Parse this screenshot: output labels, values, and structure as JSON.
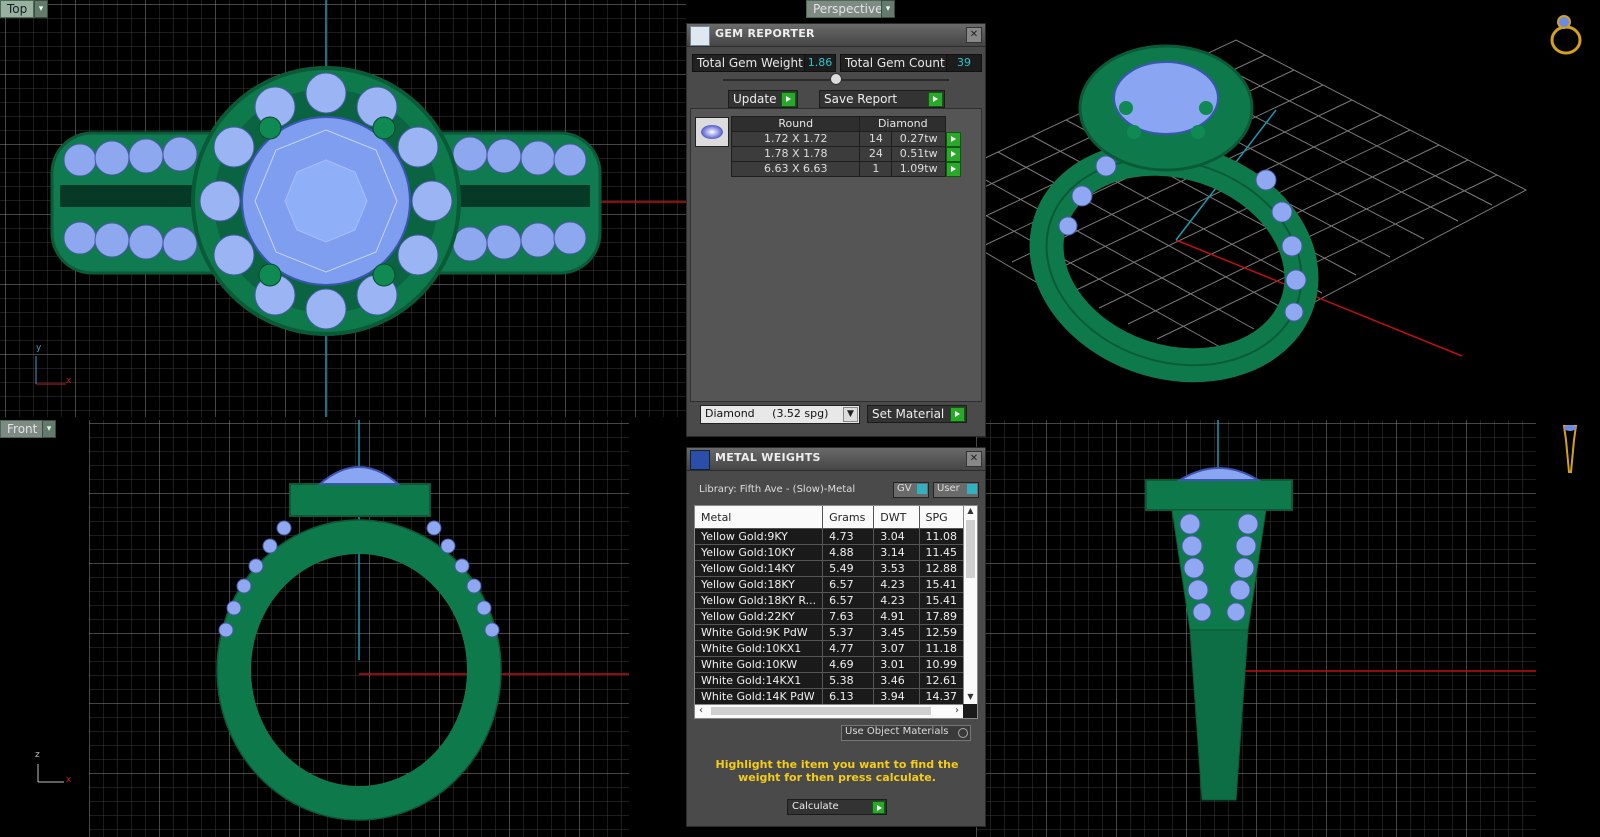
{
  "viewports": {
    "top": {
      "label": "Top",
      "axis_h": "y",
      "axis_v": "x"
    },
    "perspective": {
      "label": "Perspective"
    },
    "front": {
      "label": "Front",
      "axis_h": "z",
      "axis_v": "x"
    }
  },
  "gem_reporter": {
    "title": "GEM REPORTER",
    "total_weight_label": "Total Gem Weight",
    "total_weight_value": "1.86",
    "total_count_label": "Total Gem Count",
    "total_count_value": "39",
    "update_label": "Update",
    "save_label": "Save Report",
    "table_header_shape": "Round",
    "table_header_type": "Diamond",
    "rows": [
      {
        "size": "1.72 X 1.72",
        "count": "14",
        "weight": "0.27tw"
      },
      {
        "size": "1.78 X 1.78",
        "count": "24",
        "weight": "0.51tw"
      },
      {
        "size": "6.63 X 6.63",
        "count": "1",
        "weight": "1.09tw"
      }
    ],
    "material_select": "Diamond     (3.52 spg)",
    "set_material_label": "Set Material"
  },
  "metal_weights": {
    "title": "METAL WEIGHTS",
    "library": "Library: Fifth Ave - (Slow)-Metal",
    "gv_label": "GV",
    "user_label": "User",
    "columns": [
      "Metal",
      "Grams",
      "DWT",
      "SPG"
    ],
    "rows": [
      [
        "Yellow Gold:9KY",
        "4.73",
        "3.04",
        "11.08"
      ],
      [
        "Yellow Gold:10KY",
        "4.88",
        "3.14",
        "11.45"
      ],
      [
        "Yellow Gold:14KY",
        "5.49",
        "3.53",
        "12.88"
      ],
      [
        "Yellow Gold:18KY",
        "6.57",
        "4.23",
        "15.41"
      ],
      [
        "Yellow Gold:18KY R...",
        "6.57",
        "4.23",
        "15.41"
      ],
      [
        "Yellow Gold:22KY",
        "7.63",
        "4.91",
        "17.89"
      ],
      [
        "White Gold:9K PdW",
        "5.37",
        "3.45",
        "12.59"
      ],
      [
        "White Gold:10KX1",
        "4.77",
        "3.07",
        "11.18"
      ],
      [
        "White Gold:10KW",
        "4.69",
        "3.01",
        "10.99"
      ],
      [
        "White Gold:14KX1",
        "5.38",
        "3.46",
        "12.61"
      ],
      [
        "White Gold:14K PdW",
        "6.13",
        "3.94",
        "14.37"
      ]
    ],
    "use_object_label": "Use Object Materials",
    "hint": "Highlight the item you want to find the weight for then press calculate.",
    "calculate_label": "Calculate"
  }
}
